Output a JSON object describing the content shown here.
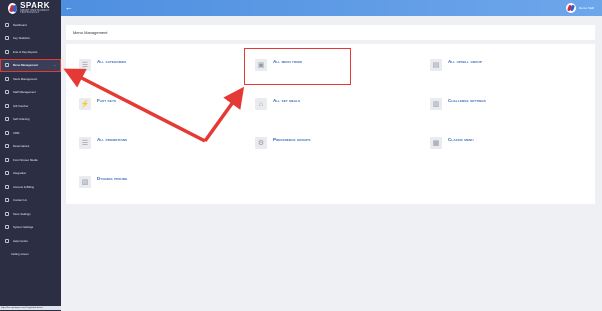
{
  "brand": {
    "name": "SPARK",
    "tagline": "SMART RESTAURANT TECHNOLOGY"
  },
  "sidebar": {
    "items": [
      {
        "label": "Dashboard",
        "icon": "dashboard-icon"
      },
      {
        "label": "Key Statistics",
        "icon": "stats-icon"
      },
      {
        "label": "End of Day Reports",
        "icon": "report-icon"
      },
      {
        "label": "Menu Management",
        "icon": "menu-icon",
        "active": true,
        "chevron": "⌄"
      },
      {
        "label": "Stock Management",
        "icon": "stock-icon"
      },
      {
        "label": "Staff Management",
        "icon": "staff-icon"
      },
      {
        "label": "Gift Voucher",
        "icon": "gift-icon"
      },
      {
        "label": "Self Ordering",
        "icon": "order-icon"
      },
      {
        "label": "CRM",
        "icon": "crm-icon"
      },
      {
        "label": "Reservations",
        "icon": "reservation-icon"
      },
      {
        "label": "Front Screen Media",
        "icon": "media-icon"
      },
      {
        "label": "Integration",
        "icon": "integration-icon"
      },
      {
        "label": "Account & Billing",
        "icon": "billing-icon"
      },
      {
        "label": "Contact Us",
        "icon": "contact-icon"
      },
      {
        "label": "Store Settings",
        "icon": "store-settings-icon"
      },
      {
        "label": "System Settings",
        "icon": "system-settings-icon"
      },
      {
        "label": "Help Centre",
        "icon": "help-icon"
      },
      {
        "label": "Ceiling screen",
        "icon": ""
      }
    ],
    "status_url": "https://ho.sparkepos.com/#/app/dashboard"
  },
  "topbar": {
    "back_symbol": "←",
    "user_name": "Demo Staff"
  },
  "page": {
    "title": "Menu Management"
  },
  "tiles": [
    {
      "label": "All categories",
      "icon": "☰"
    },
    {
      "label": "All menu items",
      "icon": "▣"
    },
    {
      "label": "All upsell group",
      "icon": "▤"
    },
    {
      "label": "Fast keys",
      "icon": "⚡"
    },
    {
      "label": "All set meals",
      "icon": "⌂"
    },
    {
      "label": "Challenge settings",
      "icon": "▥"
    },
    {
      "label": "All promotions",
      "icon": "☰"
    },
    {
      "label": "Preference groups",
      "icon": "⚙"
    },
    {
      "label": "Classic menu",
      "icon": "▦"
    },
    {
      "label": "Dynamic pricing",
      "icon": "▧"
    }
  ],
  "colors": {
    "accent": "#3565b2",
    "annotation": "#e53935",
    "sidebar": "#2c2f44",
    "topbar": "#5b98e5"
  }
}
